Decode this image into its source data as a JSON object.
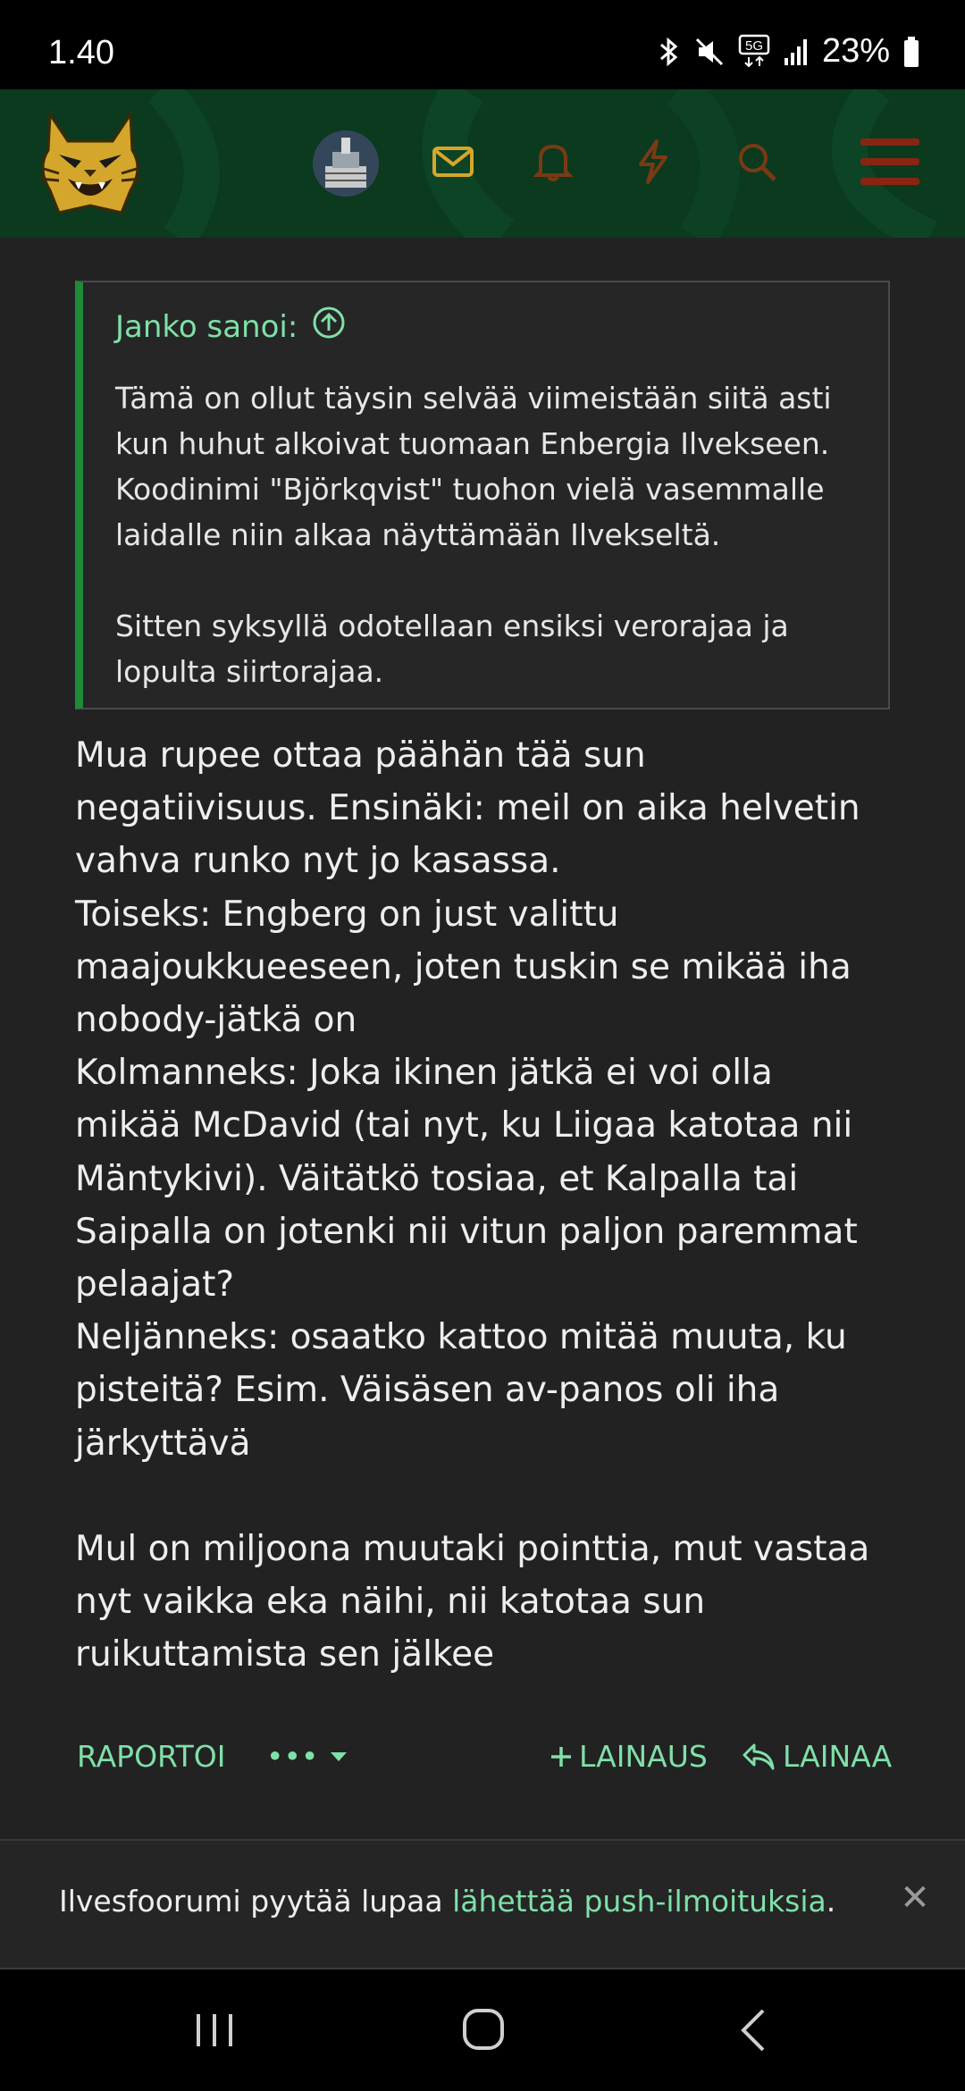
{
  "status_bar": {
    "time": "1.40",
    "battery": "23%",
    "network": "5G",
    "icons": [
      "bluetooth-icon",
      "mute-icon",
      "5g-icon",
      "signal-icon",
      "battery-icon"
    ]
  },
  "header": {
    "logo": "ilves-lynx-logo",
    "icons": [
      "avatar",
      "mail-icon",
      "bell-icon",
      "bolt-icon",
      "search-icon",
      "menu-icon"
    ],
    "colors": {
      "bg": "#0b3a1f",
      "icon": "#d4a72c",
      "icon_dim": "#7a3a14",
      "menu": "#8a2412"
    }
  },
  "quote": {
    "author": "Janko sanoi:",
    "paragraphs": [
      "Tämä on ollut täysin selvää viimeistään siitä asti kun huhut alkoivat tuomaan Enbergia Ilvekseen. Koodinimi \"Björkqvist\" tuohon vielä vasemmalle laidalle niin alkaa näyttämään Ilvekseltä.",
      "Sitten syksyllä odotellaan ensiksi verorajaa ja lopulta siirtorajaa."
    ]
  },
  "post": {
    "lines": [
      "Mua rupee ottaa päähän tää sun",
      "negatiivisuus. Ensinäki: meil on aika helvetin",
      "vahva runko nyt jo kasassa.",
      "Toiseks: Engberg on just valittu",
      "maajoukkueeseen, joten tuskin se mikää iha",
      "nobody-jätkä on",
      "Kolmanneks: Joka ikinen jätkä ei voi olla",
      "mikää McDavid (tai nyt, ku Liigaa katotaa nii",
      "Mäntykivi). Väitätkö tosiaa, et Kalpalla tai",
      "Saipalla on jotenki nii vitun paljon paremmat",
      "pelaajat?",
      "Neljänneks: osaatko kattoo mitää muuta, ku",
      "pisteitä? Esim. Väisäsen av-panos oli iha",
      "järkyttävä",
      "",
      "Mul on miljoona muutaki pointtia, mut vastaa",
      "nyt vaikka eka näihi, nii katotaa sun",
      "ruikuttamista sen jälkee"
    ]
  },
  "actions": {
    "report": "RAPORTOI",
    "more": "•••",
    "add_quote": "LAINAUS",
    "reply": "LAINAA"
  },
  "notice": {
    "text_before": "Ilvesfoorumi pyytää lupaa ",
    "link": "lähettää push-ilmoituksia",
    "text_after": ".",
    "close": "✕"
  },
  "navbar": {
    "icons": [
      "recent-apps-icon",
      "home-icon",
      "back-icon"
    ]
  },
  "colors": {
    "accent": "#7fe0a8",
    "background": "#222222",
    "quote_bar": "#1f8a3a"
  }
}
